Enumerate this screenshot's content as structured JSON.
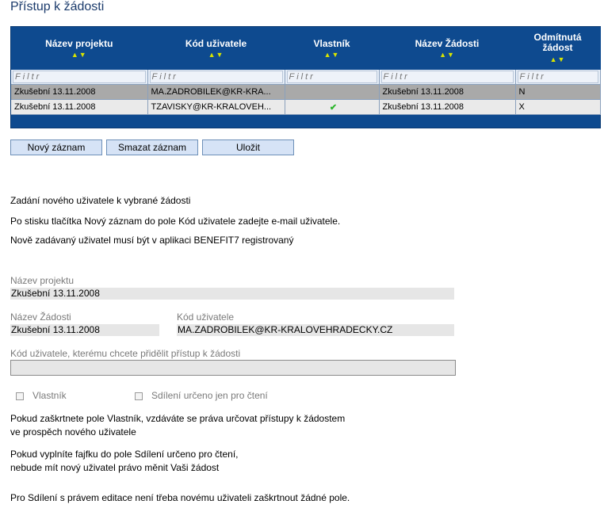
{
  "page": {
    "title": "Přístup k žádosti"
  },
  "grid": {
    "columns": [
      {
        "label": "Název projektu",
        "sort": "▲▼"
      },
      {
        "label": "Kód uživatele",
        "sort": "▲▼"
      },
      {
        "label": "Vlastník",
        "sort": "▲▼"
      },
      {
        "label": "Název Žádosti",
        "sort": "▲▼"
      },
      {
        "label": "Odmítnutá žádost",
        "sort": "▲▼"
      }
    ],
    "filter_placeholder": "Filtr",
    "rows": [
      {
        "project": "Zkušební 13.11.2008",
        "user": "MA.ZADROBILEK@KR-KRA...",
        "owner": "",
        "request": "Zkušební 13.11.2008",
        "rejected": "N"
      },
      {
        "project": "Zkušební 13.11.2008",
        "user": "TZAVISKY@KR-KRALOVEH...",
        "owner": "✔",
        "request": "Zkušební 13.11.2008",
        "rejected": "X"
      }
    ]
  },
  "buttons": {
    "new": "Nový záznam",
    "delete": "Smazat záznam",
    "save": "Uložit"
  },
  "info": {
    "heading": "Zadání nového uživatele k vybrané žádosti",
    "line1": "Po stisku tlačítka Nový záznam do pole Kód uživatele zadejte e-mail uživatele.",
    "line2": "Nově zadávaný uživatel musí být v aplikaci BENEFIT7 registrovaný"
  },
  "form": {
    "project_label": "Název projektu",
    "project_value": "Zkušební 13.11.2008",
    "request_label": "Název Žádosti",
    "request_value": "Zkušební 13.11.2008",
    "user_label": "Kód uživatele",
    "user_value": "MA.ZADROBILEK@KR-KRALOVEHRADECKY.CZ",
    "assign_label": "Kód uživatele, kterému chcete přidělit přístup k žádosti",
    "assign_value": "",
    "owner_label": "Vlastník",
    "readonly_label": "Sdílení určeno jen pro čtení"
  },
  "notes": {
    "owner_1": "Pokud zaškrtnete pole Vlastník, vzdáváte se práva určovat přístupy k žádostem",
    "owner_2": "ve prospěch nového uživatele",
    "readonly_1": "Pokud vyplníte fajfku do pole Sdílení určeno pro čtení,",
    "readonly_2": "nebude mít nový uživatel právo měnit Vaši žádost",
    "edit": "Pro Sdílení s právem editace není třeba novému uživateli zaškrtnout žádné pole."
  },
  "colors": {
    "grid_header": "#0e4a8f",
    "selected_row": "#a9a9a9",
    "button_bg": "#d6e3f6",
    "check": "#2bb52b"
  }
}
